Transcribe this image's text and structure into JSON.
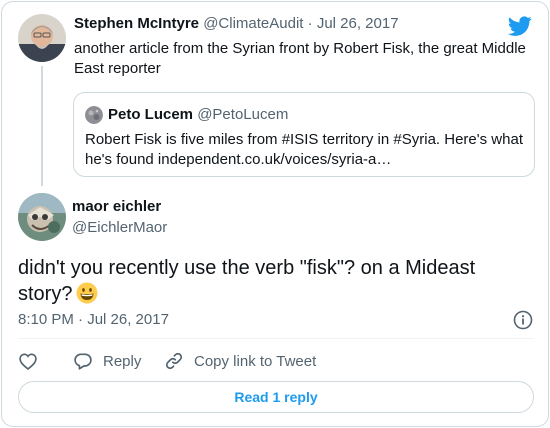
{
  "parent_tweet": {
    "author_name": "Stephen McIntyre",
    "handle": "@ClimateAudit",
    "separator": "·",
    "date": "Jul 26, 2017",
    "text": "another article from the Syrian front by Robert Fisk, the great Middle East reporter"
  },
  "quoted_tweet": {
    "author_name": "Peto Lucem",
    "handle": "@PetoLucem",
    "text": "Robert Fisk is five miles from #ISIS  territory in #Syria. Here's what he's found independent.co.uk/voices/syria-a…"
  },
  "reply_tweet": {
    "author_name": "maor eichler",
    "handle": "@EichlerMaor",
    "text": "didn't you recently use the verb \"fisk\"? on a Mideast story?",
    "emoji": "grinning-face-emoji",
    "timestamp": "8:10 PM · Jul 26, 2017"
  },
  "actions": {
    "like_icon": "heart-icon",
    "reply_label": "Reply",
    "copy_label": "Copy link to Tweet"
  },
  "read_replies_label": "Read 1 reply",
  "colors": {
    "accent": "#1d9bf0",
    "text": "#0f1419",
    "muted": "#536471",
    "border": "#cfd9de"
  }
}
